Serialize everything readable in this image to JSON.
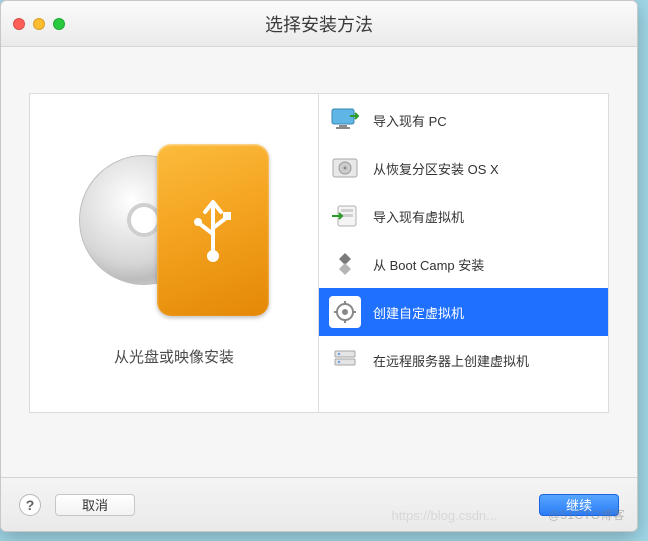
{
  "window": {
    "title": "选择安装方法"
  },
  "left": {
    "label": "从光盘或映像安装"
  },
  "options": [
    {
      "label": "导入现有 PC",
      "icon": "monitor-import-icon",
      "selected": false
    },
    {
      "label": "从恢复分区安装 OS X",
      "icon": "hdd-recovery-icon",
      "selected": false
    },
    {
      "label": "导入现有虚拟机",
      "icon": "vm-import-icon",
      "selected": false
    },
    {
      "label": "从 Boot Camp 安装",
      "icon": "bootcamp-icon",
      "selected": false
    },
    {
      "label": "创建自定虚拟机",
      "icon": "custom-vm-icon",
      "selected": true
    },
    {
      "label": "在远程服务器上创建虚拟机",
      "icon": "remote-server-icon",
      "selected": false
    }
  ],
  "footer": {
    "cancel_label": "取消",
    "continue_label": "继续",
    "help_label": "?"
  },
  "watermark": {
    "left": "https://blog.csdn...",
    "right": "@51CTO博客"
  }
}
